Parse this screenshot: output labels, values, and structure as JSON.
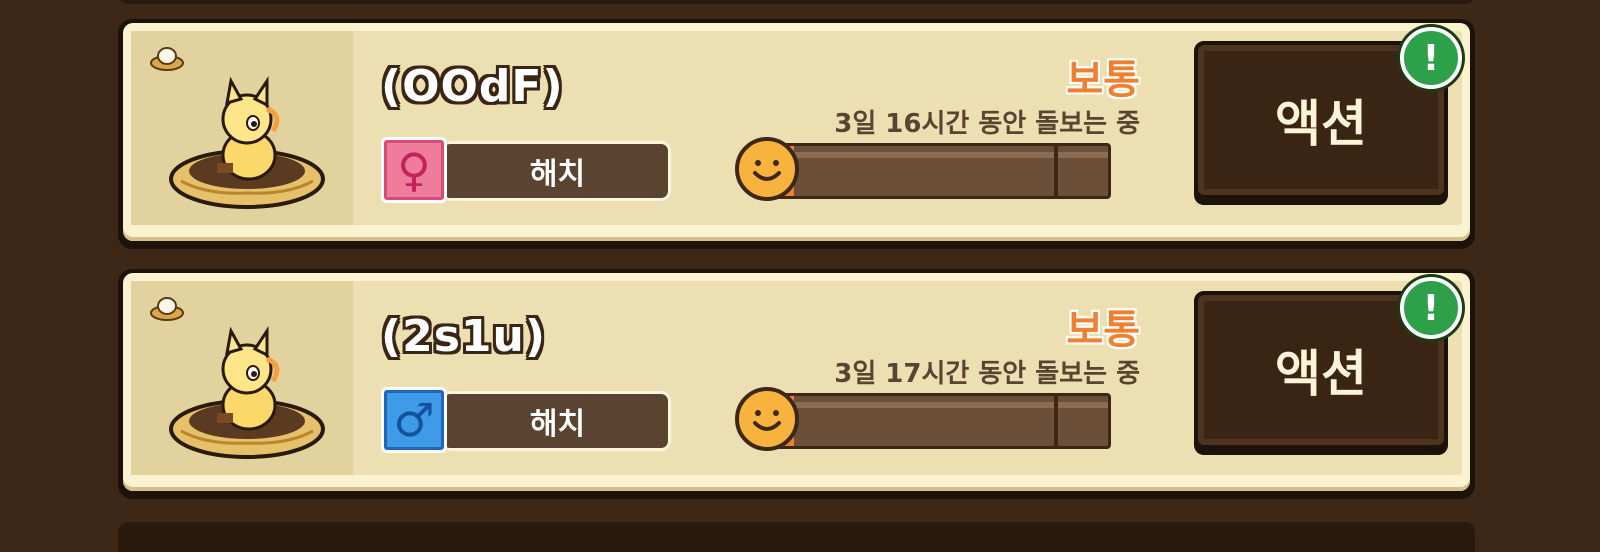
{
  "creatures": [
    {
      "name": "(OOdF)",
      "gender": "female",
      "gender_symbol": "♀",
      "stage": "해치",
      "mood": "보통",
      "care_status": "3일 16시간 동안 돌보는 중",
      "progress": 0.06,
      "action_label": "액션",
      "alert": "!"
    },
    {
      "name": "(2s1u)",
      "gender": "male",
      "gender_symbol": "♂",
      "stage": "해치",
      "mood": "보통",
      "care_status": "3일 17시간 동안 돌보는 중",
      "progress": 0.06,
      "action_label": "액션",
      "alert": "!"
    }
  ],
  "colors": {
    "background": "#3d2818",
    "card": "#fbf2cf",
    "mood": "#f08030",
    "alert_badge": "#2ea04a",
    "female": "#f07c9c",
    "male": "#3e9be8"
  }
}
